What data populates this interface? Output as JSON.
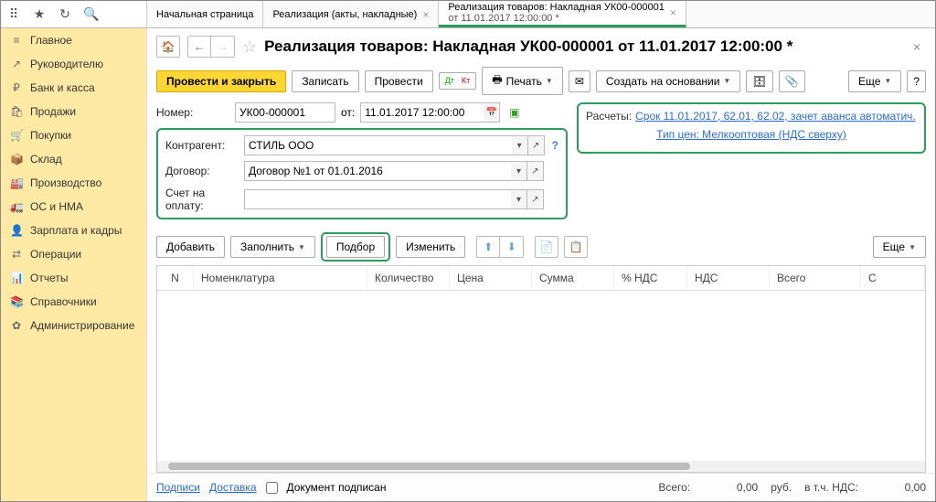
{
  "tabs": [
    {
      "label": "Начальная страница"
    },
    {
      "label": "Реализация (акты, накладные)"
    },
    {
      "label": "Реализация товаров: Накладная УК00-000001",
      "sub": "от 11.01.2017 12:00:00 *"
    }
  ],
  "sidebar": {
    "items": [
      {
        "icon": "≡",
        "label": "Главное"
      },
      {
        "icon": "↗",
        "label": "Руководителю"
      },
      {
        "icon": "₽",
        "label": "Банк и касса"
      },
      {
        "icon": "🛍",
        "label": "Продажи"
      },
      {
        "icon": "🛒",
        "label": "Покупки"
      },
      {
        "icon": "📦",
        "label": "Склад"
      },
      {
        "icon": "🏭",
        "label": "Производство"
      },
      {
        "icon": "🚛",
        "label": "ОС и НМА"
      },
      {
        "icon": "👤",
        "label": "Зарплата и кадры"
      },
      {
        "icon": "⇄",
        "label": "Операции"
      },
      {
        "icon": "📊",
        "label": "Отчеты"
      },
      {
        "icon": "📚",
        "label": "Справочники"
      },
      {
        "icon": "✿",
        "label": "Администрирование"
      }
    ]
  },
  "header": {
    "title": "Реализация товаров: Накладная УК00-000001 от 11.01.2017 12:00:00 *"
  },
  "toolbar": {
    "post_close": "Провести и закрыть",
    "save": "Записать",
    "post": "Провести",
    "print": "Печать",
    "create_based": "Создать на основании",
    "more": "Еще"
  },
  "form": {
    "number_lbl": "Номер:",
    "number": "УК00-000001",
    "from_lbl": "от:",
    "date": "11.01.2017 12:00:00",
    "contragent_lbl": "Контрагент:",
    "contragent": "СТИЛЬ ООО",
    "contract_lbl": "Договор:",
    "contract": "Договор №1 от 01.01.2016",
    "invoice_lbl": "Счет на оплату:",
    "invoice": ""
  },
  "settlement": {
    "lbl": "Расчеты:",
    "link": "Срок 11.01.2017, 62.01, 62.02, зачет аванса автоматич.",
    "price_type": "Тип цен: Мелкооптовая (НДС сверху)"
  },
  "tblToolbar": {
    "add": "Добавить",
    "fill": "Заполнить",
    "pick": "Подбор",
    "change": "Изменить",
    "more": "Еще"
  },
  "columns": {
    "n": "N",
    "item": "Номенклатура",
    "qty": "Количество",
    "price": "Цена",
    "sum": "Сумма",
    "vat_rate": "% НДС",
    "vat": "НДС",
    "total": "Всего",
    "c": "С"
  },
  "footer": {
    "signs": "Подписи",
    "delivery": "Доставка",
    "doc_signed": "Документ подписан",
    "total_lbl": "Всего:",
    "total_val": "0,00",
    "curr": "руб.",
    "vat_lbl": "в т.ч. НДС:",
    "vat_val": "0,00"
  }
}
